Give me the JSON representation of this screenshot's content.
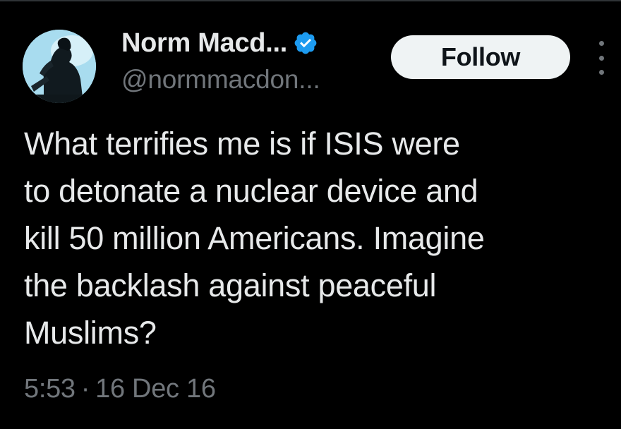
{
  "author": {
    "display_name": "Norm Macd...",
    "handle": "@normmacdon...",
    "verified": true,
    "avatar_icon": "profile-photo-silhouette"
  },
  "actions": {
    "follow_label": "Follow",
    "more_icon": "more-options-icon"
  },
  "tweet": {
    "lines": [
      "What terrifies me is if ISIS were",
      "to detonate a nuclear device and",
      "kill 50 million Americans. Imagine",
      "the backlash against peaceful",
      "Muslims?"
    ],
    "time": "5:53",
    "separator": "·",
    "date": "16 Dec 16"
  },
  "colors": {
    "background": "#000000",
    "text_primary": "#e7e9ea",
    "text_secondary": "#71767b",
    "verified_blue": "#1d9bf0",
    "follow_bg": "#eff3f4"
  }
}
